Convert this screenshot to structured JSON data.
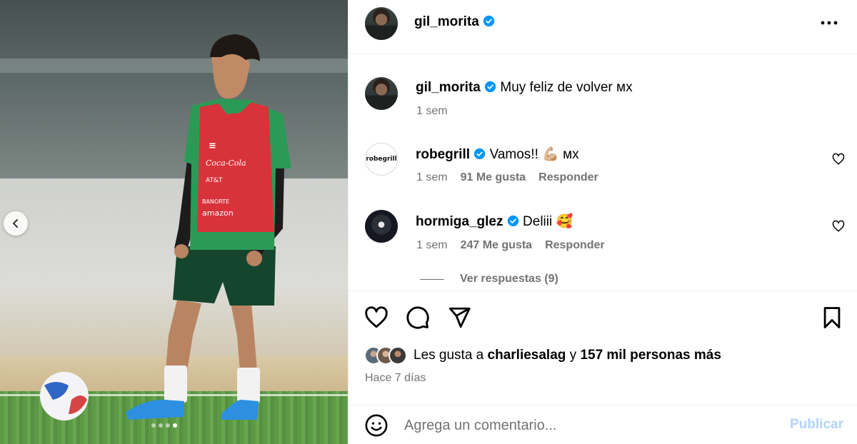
{
  "post": {
    "author": "gil_morita",
    "caption": "Muy feliz de volver",
    "caption_flag": "ᴍx",
    "caption_time": "1 sem"
  },
  "carousel": {
    "slides": 4,
    "active_index": 3
  },
  "comments": [
    {
      "username": "robegrill",
      "avatar_text": "robegrill",
      "text": "Vamos!!",
      "emoji": "💪🏼",
      "flag": "ᴍx",
      "time": "1 sem",
      "likes": "91 Me gusta",
      "reply_label": "Responder"
    },
    {
      "username": "hormiga_glez",
      "text": "Deliii",
      "emoji": "🥰",
      "time": "1 sem",
      "likes": "247 Me gusta",
      "reply_label": "Responder"
    }
  ],
  "view_replies": "Ver respuestas (9)",
  "likes_summary": {
    "prefix": "Les gusta a",
    "user": "charliesalag",
    "connector": "y",
    "others": "157 mil personas más"
  },
  "timestamp": "Hace 7 días",
  "comment_box": {
    "placeholder": "Agrega un comentario...",
    "publish_label": "Publicar"
  },
  "colors": {
    "verified": "#0095f6",
    "secondary_text": "#737373",
    "publish_disabled": "#b3d4fc"
  },
  "icons": [
    "chevron-left-icon",
    "verified-icon",
    "more-options-icon",
    "heart-icon",
    "comment-icon",
    "share-icon",
    "bookmark-icon",
    "emoji-icon"
  ]
}
